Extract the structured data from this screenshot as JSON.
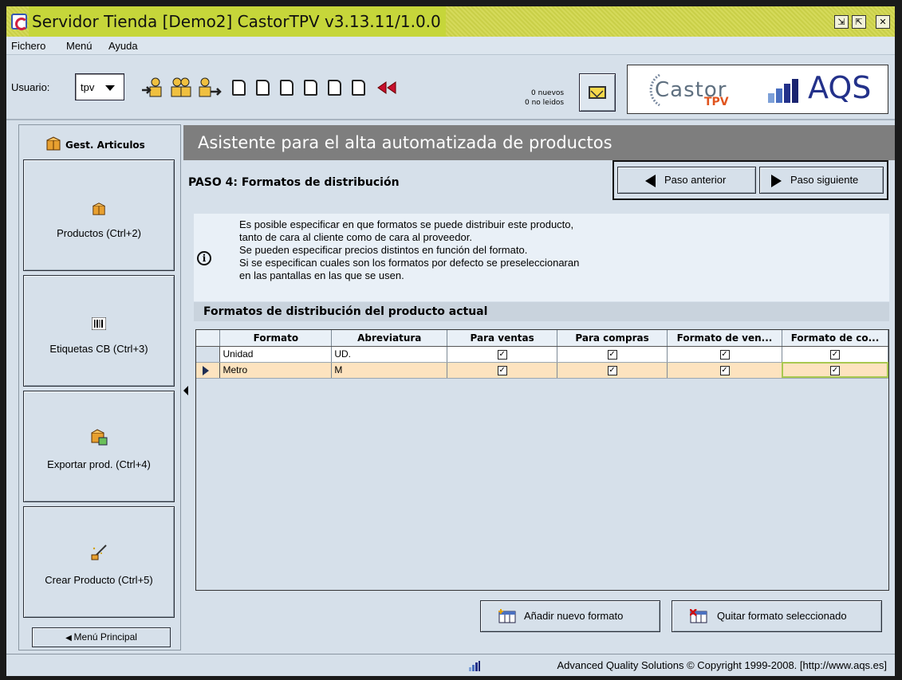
{
  "window": {
    "title": "Servidor Tienda  [Demo2] CastorTPV v3.13.11/1.0.0",
    "buttons": {
      "restore": "⇲",
      "maximize": "⇱",
      "close": "✕"
    }
  },
  "menubar": {
    "items": [
      "Fichero",
      "Menú",
      "Ayuda"
    ]
  },
  "toolbar": {
    "user_label": "Usuario:",
    "user_value": "tpv",
    "mail": {
      "new": "0 nuevos",
      "unread": "0 no leidos"
    },
    "logo_castor": "Castor",
    "logo_tpv": "TPV",
    "logo_aqs": "AQS"
  },
  "sidebar": {
    "header": "Gest. Articulos",
    "items": [
      {
        "label": "Productos (Ctrl+2)",
        "icon": "box-icon"
      },
      {
        "label": "Etiquetas CB (Ctrl+3)",
        "icon": "barcode-icon"
      },
      {
        "label": "Exportar prod. (Ctrl+4)",
        "icon": "export-box-icon"
      },
      {
        "label": "Crear Producto (Ctrl+5)",
        "icon": "magic-wand-icon"
      }
    ],
    "footer_button": "Menú Principal"
  },
  "main": {
    "header": "Asistente para el alta automatizada de productos",
    "step_title": "PASO 4: Formatos de distribución",
    "prev_button": "Paso anterior",
    "next_button": "Paso siguiente",
    "info_lines": [
      "Es posible especificar en que formatos se puede distribuir este producto,",
      "tanto de cara al cliente como de cara al proveedor.",
      "Se pueden especificar precios distintos en función del formato.",
      "Si se especifican cuales son los formatos por defecto se preseleccionaran",
      "en las pantallas en las que se usen."
    ],
    "grid_title": "Formatos de distribución del producto actual",
    "grid": {
      "columns": [
        "Formato",
        "Abreviatura",
        "Para ventas",
        "Para compras",
        "Formato de ven...",
        "Formato de co..."
      ],
      "rows": [
        {
          "formato": "Unidad",
          "abreviatura": "UD.",
          "para_ventas": true,
          "para_compras": true,
          "formato_ventas": true,
          "formato_compras": true,
          "selected": false
        },
        {
          "formato": "Metro",
          "abreviatura": "M",
          "para_ventas": true,
          "para_compras": true,
          "formato_ventas": true,
          "formato_compras": true,
          "selected": true
        }
      ]
    },
    "add_button": "Añadir nuevo formato",
    "remove_button": "Quitar formato seleccionado"
  },
  "statusbar": {
    "text": "Advanced Quality Solutions © Copyright 1999-2008. [http://www.aqs.es]"
  },
  "colors": {
    "title_bar": "#c6d63a",
    "panel_bg": "#d6e0ea",
    "header_gray": "#7e7e7e",
    "selected_row": "#fde3bf",
    "aqs_blue": "#23318a",
    "tpv_orange": "#e0541e"
  }
}
